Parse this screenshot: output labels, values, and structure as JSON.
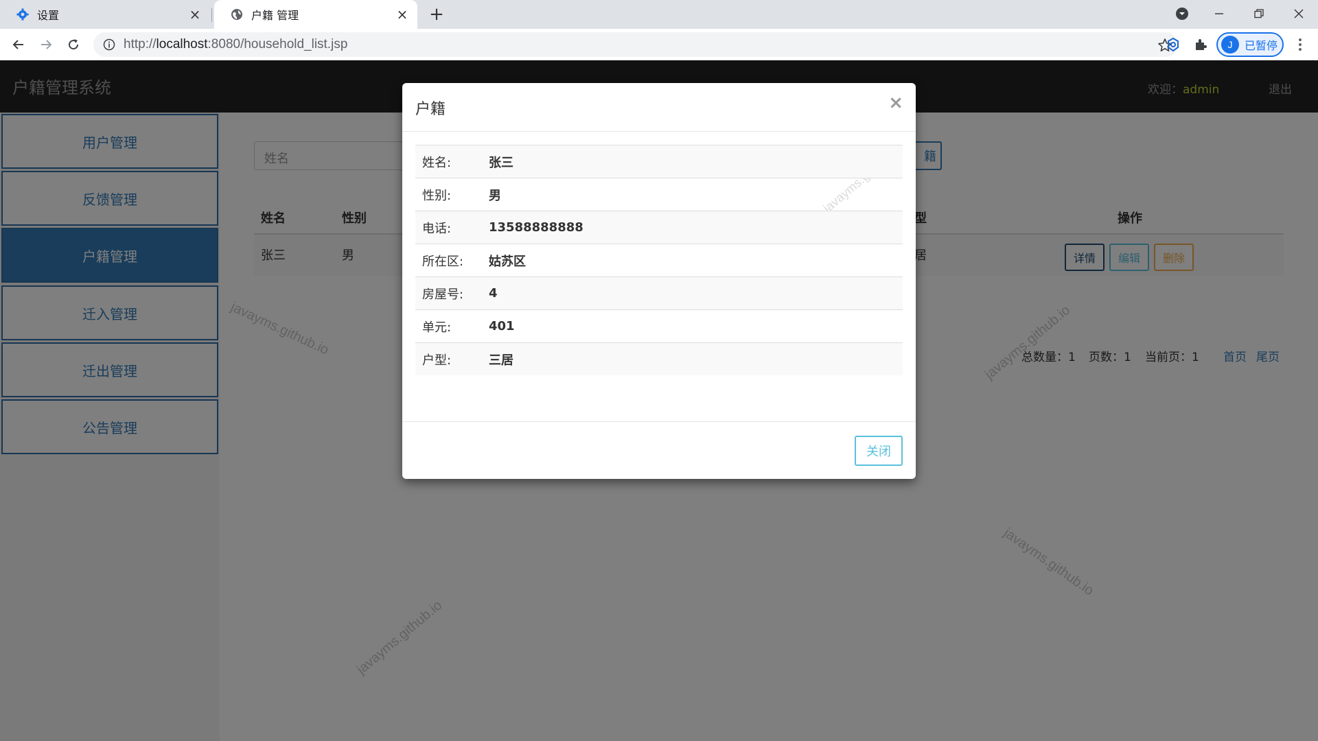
{
  "browser": {
    "tabs": [
      {
        "title": "设置",
        "icon": "gear-icon"
      },
      {
        "title": "户籍 管理",
        "icon": "globe-icon"
      }
    ],
    "url_prefix": "http://",
    "url_host": "localhost",
    "url_rest": ":8080/household_list.jsp",
    "profile_initial": "J",
    "profile_label": "已暂停"
  },
  "app": {
    "title": "户籍管理系统",
    "welcome_label": "欢迎：",
    "username": "admin",
    "logout": "退出"
  },
  "sidebar": {
    "items": [
      {
        "label": "用户管理"
      },
      {
        "label": "反馈管理"
      },
      {
        "label": "户籍管理",
        "active": true
      },
      {
        "label": "迁入管理"
      },
      {
        "label": "迁出管理"
      },
      {
        "label": "公告管理"
      }
    ]
  },
  "search": {
    "placeholder": "姓名",
    "add_button_partial": "籍"
  },
  "table": {
    "headers": {
      "name": "姓名",
      "gender": "性别",
      "type_partial": "型",
      "actions": "操作"
    },
    "rows": [
      {
        "name": "张三",
        "gender": "男",
        "type_partial": "居"
      }
    ],
    "buttons": {
      "detail": "详情",
      "edit": "编辑",
      "delete": "删除"
    }
  },
  "pager": {
    "total_label": "总数量：",
    "total": "1",
    "pages_label": "页数：",
    "pages": "1",
    "current_label": "当前页：",
    "current": "1",
    "first": "首页",
    "last": "尾页"
  },
  "watermark": "javayms.github.io",
  "modal": {
    "title": "户籍",
    "close_x": "×",
    "fields": [
      {
        "label": "姓名:",
        "value": "张三"
      },
      {
        "label": "性别:",
        "value": "男"
      },
      {
        "label": "电话:",
        "value": "13588888888"
      },
      {
        "label": "所在区:",
        "value": "姑苏区"
      },
      {
        "label": "房屋号:",
        "value": "4"
      },
      {
        "label": "单元:",
        "value": "401"
      },
      {
        "label": "户型:",
        "value": "三居"
      }
    ],
    "close_button": "关闭"
  },
  "colors": {
    "primary": "#337ab7",
    "info": "#5bc0de",
    "warning": "#f0ad4e",
    "header_bg": "#222222",
    "username": "#c5d93a"
  }
}
